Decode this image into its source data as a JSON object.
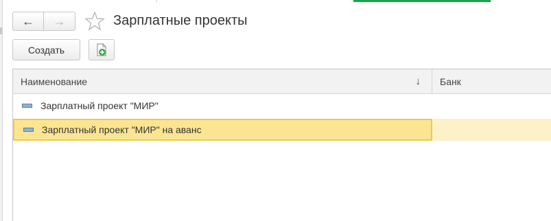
{
  "window": {
    "title": "Зарплатные проекты"
  },
  "toolbar": {
    "create_label": "Создать"
  },
  "table": {
    "columns": [
      "Наименование",
      "Банк"
    ],
    "rows": [
      {
        "name": "Зарплатный проект \"МИР\"",
        "bank": "",
        "selected": false
      },
      {
        "name": "Зарплатный проект \"МИР\" на аванс",
        "bank": "",
        "selected": true
      }
    ]
  },
  "icons": {
    "back": "arrow-left-icon",
    "forward": "arrow-right-icon",
    "favorite": "star-icon",
    "add": "add-document-icon",
    "sort": "sort-down-icon",
    "item": "catalog-item-icon"
  },
  "colors": {
    "selected_row": "#fbe592",
    "selected_border": "#f2c84b",
    "active_tab": "#17a64b"
  }
}
